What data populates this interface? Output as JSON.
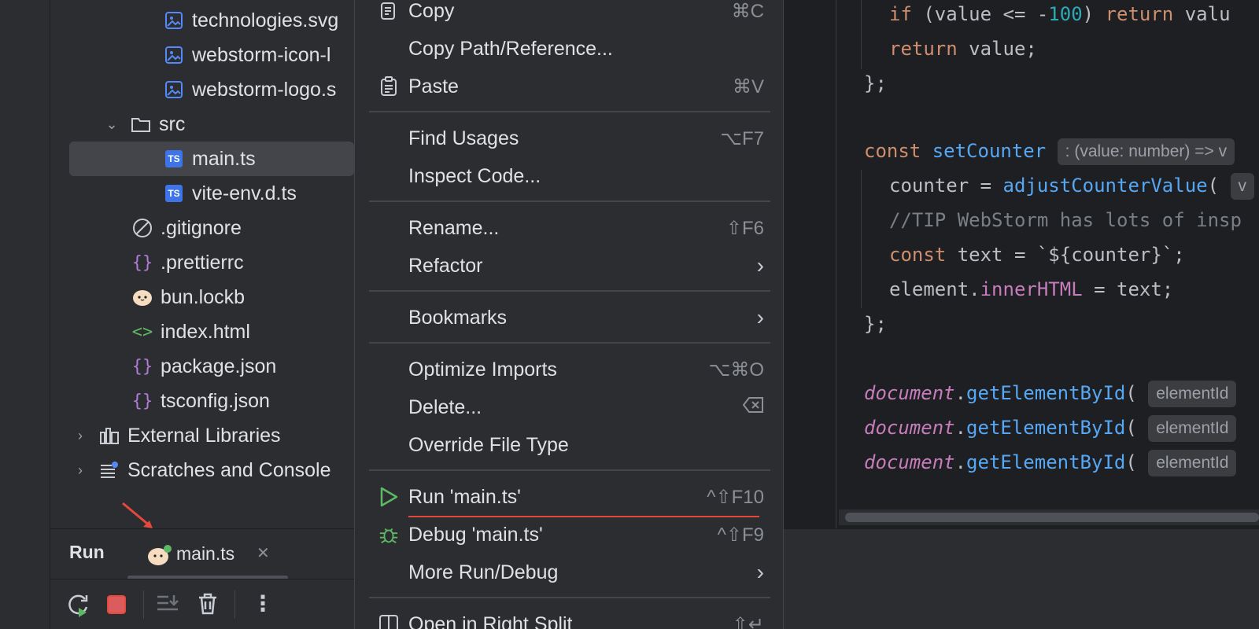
{
  "project_tree": {
    "items": [
      {
        "label": "technologies.svg",
        "icon": "image-file-icon"
      },
      {
        "label": "webstorm-icon-l",
        "icon": "image-file-icon"
      },
      {
        "label": "webstorm-logo.s",
        "icon": "image-file-icon"
      },
      {
        "label": "src",
        "icon": "folder-icon"
      },
      {
        "label": "main.ts",
        "icon": "typescript-file-icon"
      },
      {
        "label": "vite-env.d.ts",
        "icon": "typescript-file-icon"
      },
      {
        "label": ".gitignore",
        "icon": "gitignore-icon"
      },
      {
        "label": ".prettierrc",
        "icon": "braces-icon"
      },
      {
        "label": "bun.lockb",
        "icon": "bun-icon"
      },
      {
        "label": "index.html",
        "icon": "html-icon"
      },
      {
        "label": "package.json",
        "icon": "braces-icon"
      },
      {
        "label": "tsconfig.json",
        "icon": "braces-icon"
      },
      {
        "label": "External Libraries",
        "icon": "library-icon"
      },
      {
        "label": "Scratches and Console",
        "icon": "scratches-icon"
      }
    ]
  },
  "ts_badge": "TS",
  "run_panel": {
    "title": "Run",
    "tab_label": "main.ts",
    "close": "✕",
    "more": "⋮"
  },
  "context_menu": {
    "copy": {
      "label": "Copy",
      "shortcut": "⌘C"
    },
    "copy_path": {
      "label": "Copy Path/Reference..."
    },
    "paste": {
      "label": "Paste",
      "shortcut": "⌘V"
    },
    "find_usages": {
      "label": "Find Usages",
      "shortcut": "⌥F7"
    },
    "inspect_code": {
      "label": "Inspect Code..."
    },
    "rename": {
      "label": "Rename...",
      "shortcut": "⇧F6"
    },
    "refactor": {
      "label": "Refactor"
    },
    "bookmarks": {
      "label": "Bookmarks"
    },
    "optimize_imports": {
      "label": "Optimize Imports",
      "shortcut": "⌥⌘O"
    },
    "delete": {
      "label": "Delete..."
    },
    "override_file_type": {
      "label": "Override File Type"
    },
    "run": {
      "label": "Run 'main.ts'",
      "shortcut": "^⇧F10"
    },
    "debug": {
      "label": "Debug 'main.ts'",
      "shortcut": "^⇧F9"
    },
    "more_run_debug": {
      "label": "More Run/Debug"
    },
    "open_right_split": {
      "label": "Open in Right Split",
      "shortcut": "⇧↵"
    }
  },
  "editor": {
    "line1": {
      "if": "if",
      "a": " (value <= -",
      "num": "100",
      "b": ") ",
      "ret": "return",
      "c": " valu"
    },
    "line2": {
      "ret": "return",
      "a": " value;"
    },
    "line3": "};",
    "line4": {
      "kw": "const",
      "fn": "setCounter",
      "hint": ": (value: number) => v"
    },
    "line5": {
      "a": "counter = ",
      "fn": "adjustCounterValue",
      "b": "( ",
      "hint": "v"
    },
    "line6": "//TIP WebStorm has lots of insp",
    "line7": {
      "kw": "const",
      "a": " text = `${counter}`;"
    },
    "line8": {
      "a": "element.",
      "prop": "innerHTML",
      "b": " = text;"
    },
    "line9": "};",
    "doc_lines": [
      {
        "obj": "document",
        "dot": ".",
        "fn": "getElementById",
        "paren": "(",
        "hint": "elementId"
      },
      {
        "obj": "document",
        "dot": ".",
        "fn": "getElementById",
        "paren": "(",
        "hint": "elementId"
      },
      {
        "obj": "document",
        "dot": ".",
        "fn": "getElementById",
        "paren": "(",
        "hint": "elementId"
      }
    ]
  },
  "colors": {
    "accent_red": "#e5483c",
    "run_green": "#5fb865",
    "stop_red": "#db5c5c"
  }
}
